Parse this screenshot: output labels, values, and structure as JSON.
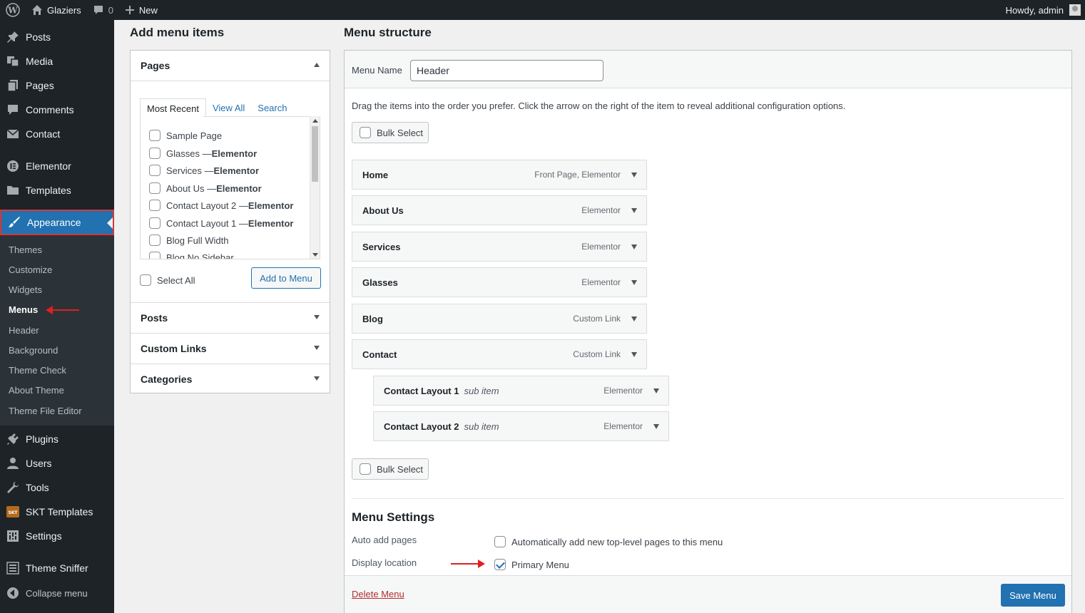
{
  "admin_bar": {
    "site_name": "Glaziers",
    "comments_count": "0",
    "new_label": "New",
    "greeting": "Howdy, admin"
  },
  "sidebar": {
    "items_top": [
      {
        "label": "Posts",
        "icon": "pin-icon"
      },
      {
        "label": "Media",
        "icon": "media-icon"
      },
      {
        "label": "Pages",
        "icon": "pages-icon"
      },
      {
        "label": "Comments",
        "icon": "comment-icon"
      },
      {
        "label": "Contact",
        "icon": "mail-icon"
      },
      {
        "label": "Elementor",
        "icon": "elementor-icon"
      },
      {
        "label": "Templates",
        "icon": "folder-icon"
      },
      {
        "label": "Appearance",
        "icon": "brush-icon"
      }
    ],
    "appearance_submenu": [
      "Themes",
      "Customize",
      "Widgets",
      "Menus",
      "Header",
      "Background",
      "Theme Check",
      "About Theme",
      "Theme File Editor"
    ],
    "items_bottom": [
      {
        "label": "Plugins",
        "icon": "plugin-icon"
      },
      {
        "label": "Users",
        "icon": "user-icon"
      },
      {
        "label": "Tools",
        "icon": "wrench-icon"
      },
      {
        "label": "SKT Templates",
        "icon": "skt-icon"
      },
      {
        "label": "Settings",
        "icon": "settings-icon"
      },
      {
        "label": "Theme Sniffer",
        "icon": "list-icon"
      },
      {
        "label": "Collapse menu",
        "icon": "collapse-icon"
      }
    ]
  },
  "add_items": {
    "heading": "Add menu items",
    "pages_section": {
      "title": "Pages",
      "tabs": [
        "Most Recent",
        "View All",
        "Search"
      ],
      "items": [
        {
          "name": "Sample Page",
          "suffix": ""
        },
        {
          "name": "Glasses — ",
          "suffix": "Elementor"
        },
        {
          "name": "Services — ",
          "suffix": "Elementor"
        },
        {
          "name": "About Us — ",
          "suffix": "Elementor"
        },
        {
          "name": "Contact Layout 2 — ",
          "suffix": "Elementor"
        },
        {
          "name": "Contact Layout 1 — ",
          "suffix": "Elementor"
        },
        {
          "name": "Blog Full Width",
          "suffix": ""
        },
        {
          "name": "Blog No Sidebar",
          "suffix": ""
        }
      ],
      "select_all_label": "Select All",
      "add_button": "Add to Menu"
    },
    "sections": [
      "Posts",
      "Custom Links",
      "Categories"
    ]
  },
  "menu_structure": {
    "heading": "Menu structure",
    "menu_name_label": "Menu Name",
    "menu_name_value": "Header",
    "instructions": "Drag the items into the order you prefer. Click the arrow on the right of the item to reveal additional configuration options.",
    "bulk_select_label": "Bulk Select",
    "items": [
      {
        "title": "Home",
        "sub": "",
        "type": "Front Page, Elementor"
      },
      {
        "title": "About Us",
        "sub": "",
        "type": "Elementor"
      },
      {
        "title": "Services",
        "sub": "",
        "type": "Elementor"
      },
      {
        "title": "Glasses",
        "sub": "",
        "type": "Elementor"
      },
      {
        "title": "Blog",
        "sub": "",
        "type": "Custom Link"
      },
      {
        "title": "Contact",
        "sub": "",
        "type": "Custom Link"
      },
      {
        "title": "Contact Layout 1",
        "sub": "sub item",
        "type": "Elementor"
      },
      {
        "title": "Contact Layout 2",
        "sub": "sub item",
        "type": "Elementor"
      }
    ],
    "settings": {
      "heading": "Menu Settings",
      "auto_add_label": "Auto add pages",
      "auto_add_option": "Automatically add new top-level pages to this menu",
      "auto_add_checked": false,
      "display_location_label": "Display location",
      "location_option": "Primary Menu",
      "location_checked": true
    },
    "delete_label": "Delete Menu",
    "save_label": "Save Menu"
  },
  "colors": {
    "admin_dark": "#1d2327",
    "accent_blue": "#2271b1",
    "highlight_red": "#e02020"
  }
}
